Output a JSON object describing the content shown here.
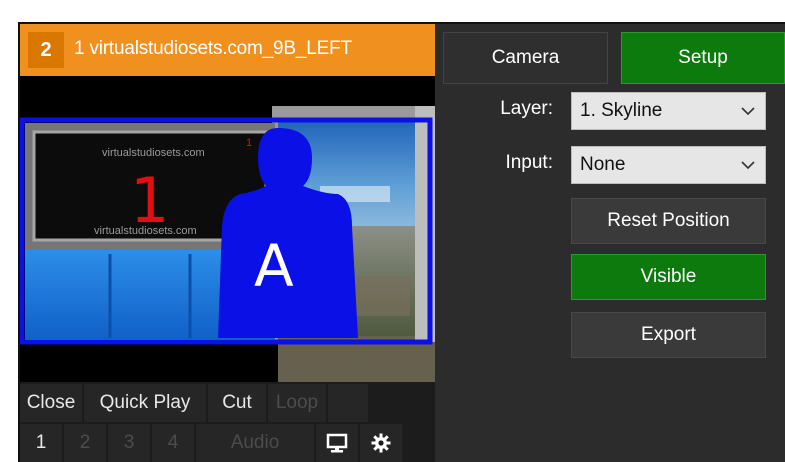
{
  "input": {
    "number": "2",
    "title": "1 virtualstudiosets.com_9B_LEFT",
    "preview": {
      "screen_top_text": "virtualstudiosets.com",
      "screen_number": "1",
      "screen_bottom_text": "virtualstudiosets.com",
      "screen_corner": "1",
      "person_letter": "A"
    },
    "controls_row1": [
      "Close",
      "Quick Play",
      "Cut",
      "Loop"
    ],
    "controls_row2": [
      "1",
      "2",
      "3",
      "4",
      "Audio"
    ],
    "icons": [
      "monitor-icon",
      "gear-icon"
    ]
  },
  "setup": {
    "tabs": {
      "camera": "Camera",
      "setup": "Setup"
    },
    "layer": {
      "label": "Layer:",
      "value": "1. Skyline"
    },
    "inputs": {
      "label": "Input:",
      "value": "None"
    },
    "buttons": {
      "reset": "Reset Position",
      "visible": "Visible",
      "export": "Export"
    }
  },
  "colors": {
    "title_bar": "#f0901e",
    "active_green": "#0c7a0c",
    "chroma_blue": "#0a10e6",
    "screen_red": "#e01010"
  }
}
